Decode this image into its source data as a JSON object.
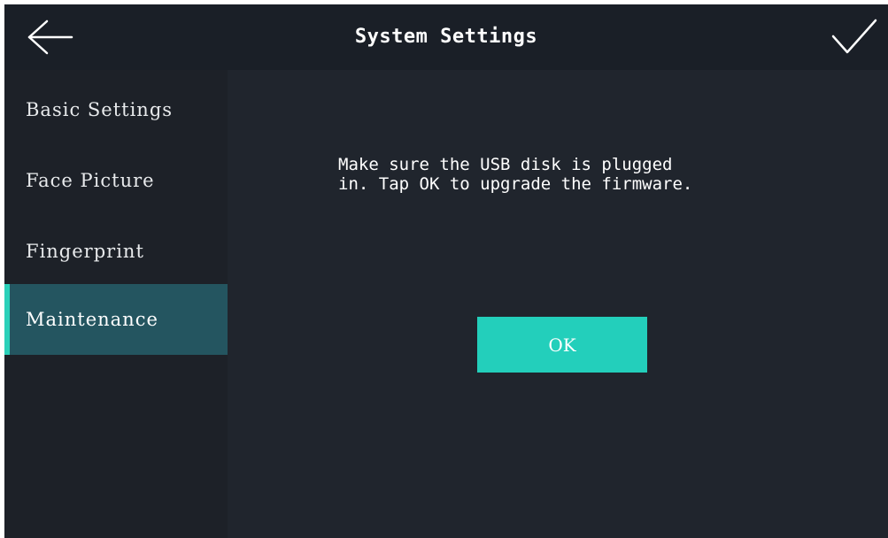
{
  "header": {
    "title": "System Settings",
    "back_icon": "arrow-left-icon",
    "confirm_icon": "checkmark-icon"
  },
  "sidebar": {
    "items": [
      {
        "label": "Basic Settings",
        "active": false
      },
      {
        "label": "Face Picture",
        "active": false
      },
      {
        "label": "Fingerprint",
        "active": false
      },
      {
        "label": "Maintenance",
        "active": true
      }
    ]
  },
  "main": {
    "message": "Make sure the USB disk is plugged\nin. Tap OK to upgrade the firmware.",
    "ok_label": "OK"
  },
  "colors": {
    "background": "#1c2129",
    "active_item": "#245560",
    "accent": "#2ad0b9",
    "button": "#23cfbb"
  }
}
